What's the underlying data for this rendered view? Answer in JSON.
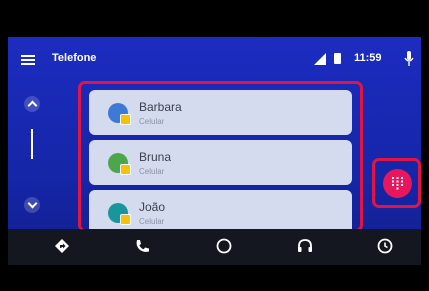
{
  "header": {
    "title": "Telefone",
    "time": "11:59"
  },
  "contacts": [
    {
      "name": "Barbara",
      "type": "Celular",
      "color": "#3d7ad6"
    },
    {
      "name": "Bruna",
      "type": "Celular",
      "color": "#4ca64a"
    },
    {
      "name": "João",
      "type": "Celular",
      "color": "#17969c"
    }
  ],
  "icons": {
    "menu": "menu-icon",
    "signal": "signal-icon",
    "battery": "battery-icon",
    "mic": "mic-icon",
    "dialpad": "dialpad-icon",
    "nav": [
      "navigation-icon",
      "phone-icon",
      "home-icon",
      "music-icon",
      "recents-icon"
    ]
  },
  "colors": {
    "accent": "#e8175d",
    "highlight": "#e01546",
    "background": "#1a2bb8",
    "navbar": "#14171f"
  }
}
